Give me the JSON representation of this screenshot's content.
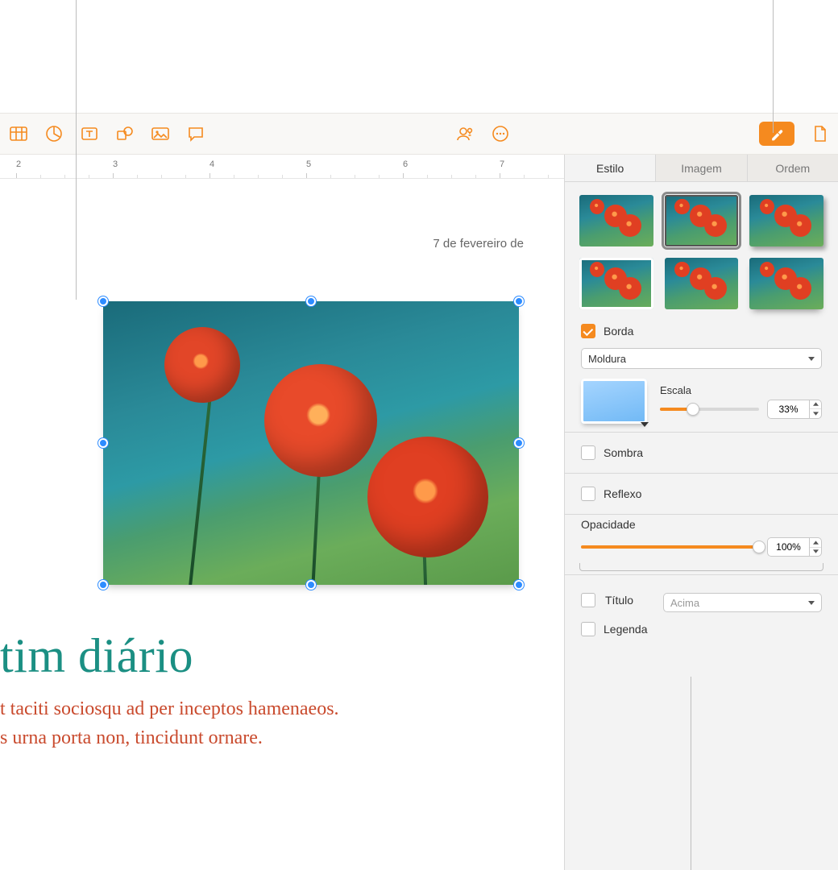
{
  "toolbar": {
    "icons": [
      "table",
      "chart",
      "text",
      "shape",
      "media",
      "comment",
      "collaborate",
      "more",
      "format",
      "document"
    ]
  },
  "ruler": {
    "majors": [
      2,
      3,
      4,
      5,
      6,
      7
    ]
  },
  "document": {
    "date": "7 de fevereiro de",
    "title": "tim diário",
    "body_line1": "t taciti sociosqu ad per inceptos hamenaeos.",
    "body_line2": "s urna porta non, tincidunt ornare."
  },
  "inspector": {
    "tabs": {
      "style": "Estilo",
      "image": "Imagem",
      "arrange": "Ordem",
      "active": "style"
    },
    "style_thumbs": [
      "plain",
      "selected",
      "shadow",
      "frame",
      "reflect",
      "curl"
    ],
    "border": {
      "checkbox_label": "Borda",
      "checked": true,
      "type_label": "Moldura",
      "scale_label": "Escala",
      "scale_value": "33%",
      "scale_pct": 33
    },
    "shadow": {
      "label": "Sombra",
      "checked": false
    },
    "reflect": {
      "label": "Reflexo",
      "checked": false
    },
    "opacity": {
      "label": "Opacidade",
      "value": "100%",
      "pct": 100
    },
    "title": {
      "label": "Título",
      "checked": false,
      "position": "Acima"
    },
    "caption": {
      "label": "Legenda",
      "checked": false
    }
  }
}
